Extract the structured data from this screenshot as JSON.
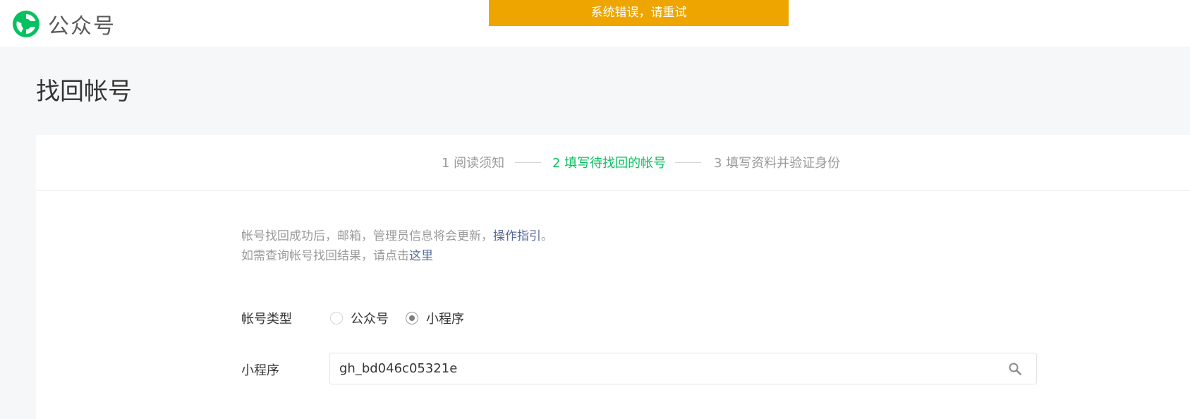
{
  "header": {
    "logo_icon": "wechat-official-account-logo-icon",
    "logo_text": "公众号",
    "brand_color": "#07c160"
  },
  "toast": {
    "message": "系统错误，请重试",
    "color": "#eea500"
  },
  "page": {
    "title": "找回帐号"
  },
  "steps": [
    {
      "label": "1 阅读须知",
      "active": false
    },
    {
      "label": "2 填写待找回的帐号",
      "active": true
    },
    {
      "label": "3 填写资料并验证身份",
      "active": false
    }
  ],
  "notice": {
    "line1_text": "帐号找回成功后，邮箱，管理员信息将会更新，",
    "line1_link": "操作指引",
    "line1_end": "。",
    "line2_text": "如需查询帐号找回结果，请点击",
    "line2_link": "这里",
    "link_color": "#576b95"
  },
  "form": {
    "account_type_label": "帐号类型",
    "account_type_options": [
      {
        "label": "公众号",
        "checked": false
      },
      {
        "label": "小程序",
        "checked": true
      }
    ],
    "account_label": "小程序",
    "account_value": "gh_bd046c05321e",
    "search_icon": "search-icon"
  }
}
